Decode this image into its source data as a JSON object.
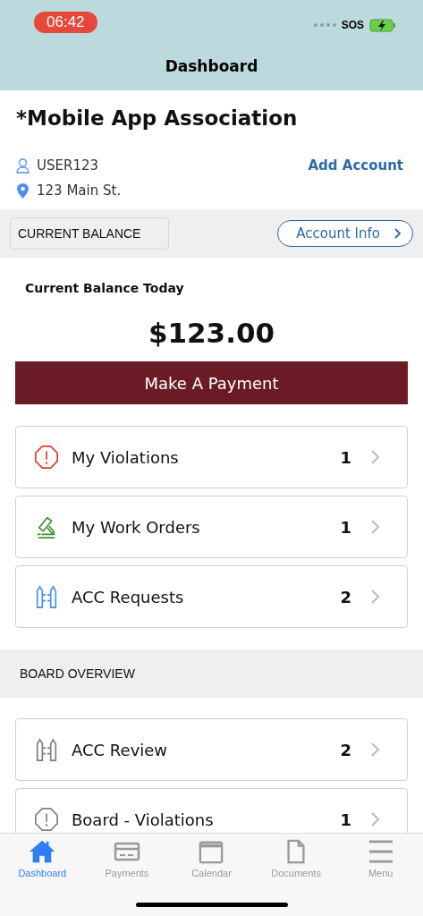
{
  "status_bar": {
    "time": "06:42",
    "carrier": "SOS"
  },
  "header": {
    "title": "Dashboard"
  },
  "account": {
    "name": "*Mobile App Association",
    "user": "USER123",
    "address": "123 Main St.",
    "add_account": "Add Account"
  },
  "balance_bar": {
    "label": "CURRENT BALANCE",
    "account_info": "Account Info"
  },
  "balance": {
    "caption": "Current Balance Today",
    "amount": "$123.00",
    "pay_button": "Make A Payment"
  },
  "my_items": [
    {
      "kind": "violation",
      "label": "My Violations",
      "count": "1",
      "color": "#e8392f"
    },
    {
      "kind": "work-order",
      "label": "My Work Orders",
      "count": "1",
      "color": "#3f8f2f"
    },
    {
      "kind": "acc",
      "label": "ACC Requests",
      "count": "2",
      "color": "#4a8ff0"
    }
  ],
  "board_overview": {
    "title": "BOARD OVERVIEW",
    "items": [
      {
        "kind": "acc",
        "label": "ACC Review",
        "count": "2",
        "color": "#808080"
      },
      {
        "kind": "violation",
        "label": "Board - Violations",
        "count": "1",
        "color": "#808080"
      }
    ]
  },
  "tab_bar": [
    {
      "kind": "home",
      "label": "Dashboard",
      "selected": true
    },
    {
      "kind": "card",
      "label": "Payments",
      "selected": false
    },
    {
      "kind": "calendar",
      "label": "Calendar",
      "selected": false
    },
    {
      "kind": "document",
      "label": "Documents",
      "selected": false
    },
    {
      "kind": "menu",
      "label": "Menu",
      "selected": false
    }
  ]
}
